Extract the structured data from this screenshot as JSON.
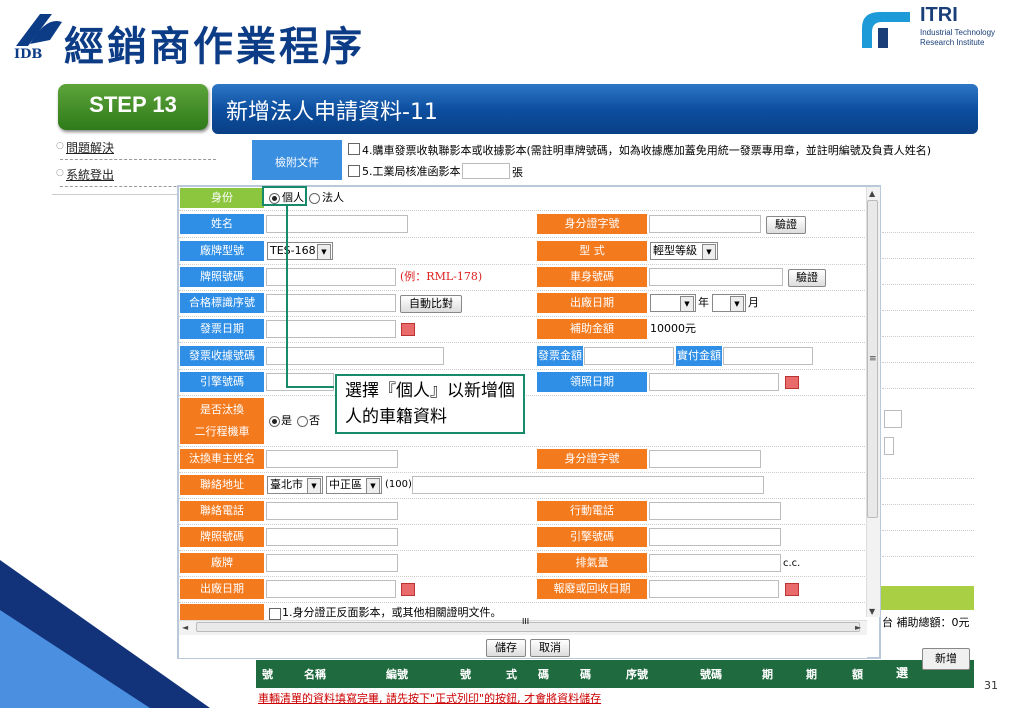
{
  "slide": {
    "title": "經銷商作業程序",
    "page_number": "31",
    "logo_left": "IDB",
    "logo_right": {
      "main": "ITRI",
      "line1": "Industrial Technology",
      "line2": "Research Institute"
    },
    "step_label": "STEP 13",
    "step_title": "新增法人申請資料-11"
  },
  "side_menu": {
    "items": [
      "問題解決",
      "系統登出"
    ]
  },
  "background_page": {
    "doc_label": "檢附文件",
    "check1": "4.購車發票收執聯影本或收據影本(需註明車牌號碼，如為收據應加蓋免用統一發票專用章，並註明編號及負責人姓名)",
    "check2": "5.工業局核准函影本 1",
    "check2_unit": "張",
    "subsidy_text": "台 補助總額：0元",
    "select_all": "全",
    "select_all_2": "選",
    "add_button": "新增",
    "table_headers": [
      "號",
      "名稱",
      "編號",
      "號",
      "式",
      "碼",
      "碼",
      "序號",
      "號碼",
      "期",
      "期",
      "額"
    ],
    "footnote": "車輛清單的資料填寫完畢, 請先按下\"正式列印\"的按鈕, 才會將資料儲存"
  },
  "form": {
    "identity_label": "身份",
    "identity_options": [
      "個人",
      "法人"
    ],
    "identity_selected": "個人",
    "name_label": "姓名",
    "id_label": "身分證字號",
    "verify_button": "驗證",
    "brand_model_label": "廠牌型號",
    "brand_model_value": "TES-168",
    "type_label": "型 式",
    "type_value": "輕型等級",
    "plate_label": "牌照號碼",
    "plate_hint": "(例：RML-178)",
    "body_no_label": "車身號碼",
    "body_verify_button": "驗證",
    "cert_label": "合格標識序號",
    "auto_compare_button": "自動比對",
    "factory_date_label": "出廠日期",
    "year_unit": "年",
    "month_unit": "月",
    "invoice_date_label": "發票日期",
    "subsidy_label": "補助金額",
    "subsidy_value": "10000元",
    "invoice_no_label": "發票收據號碼",
    "invoice_amount_label": "發票金額",
    "paid_amount_label": "實付金額",
    "engine_label": "引擎號碼",
    "license_date_label": "領照日期",
    "replace_label_1": "是否汰換",
    "replace_label_2": "二行程機車",
    "replace_options": [
      "是",
      "否"
    ],
    "old_owner_label": "汰換車主姓名",
    "old_owner_id_label": "身分證字號",
    "address_label": "聯絡地址",
    "city_value": "臺北市",
    "district_value": "中正區",
    "zip_value": "(100)",
    "phone_label": "聯絡電話",
    "mobile_label": "行動電話",
    "old_plate_label": "牌照號碼",
    "old_engine_label": "引擎號碼",
    "old_brand_label": "廠牌",
    "displacement_label": "排氣量",
    "displacement_unit": "c.c.",
    "old_factory_date_label": "出廠日期",
    "scrap_date_label": "報廢或回收日期",
    "id_copy_check": "1.身分證正反面影本，或其他相關證明文件。",
    "save_button": "儲存",
    "cancel_button": "取消",
    "scroll_mark": "III"
  },
  "callout": {
    "text": "選擇『個人』以新增個人的車籍資料"
  },
  "colors": {
    "blue_label": "#2f8ee6",
    "orange_label": "#f47a1e",
    "green_label": "#8cc63e",
    "callout_border": "#178a6a",
    "title_blue": "#0d3c87"
  }
}
